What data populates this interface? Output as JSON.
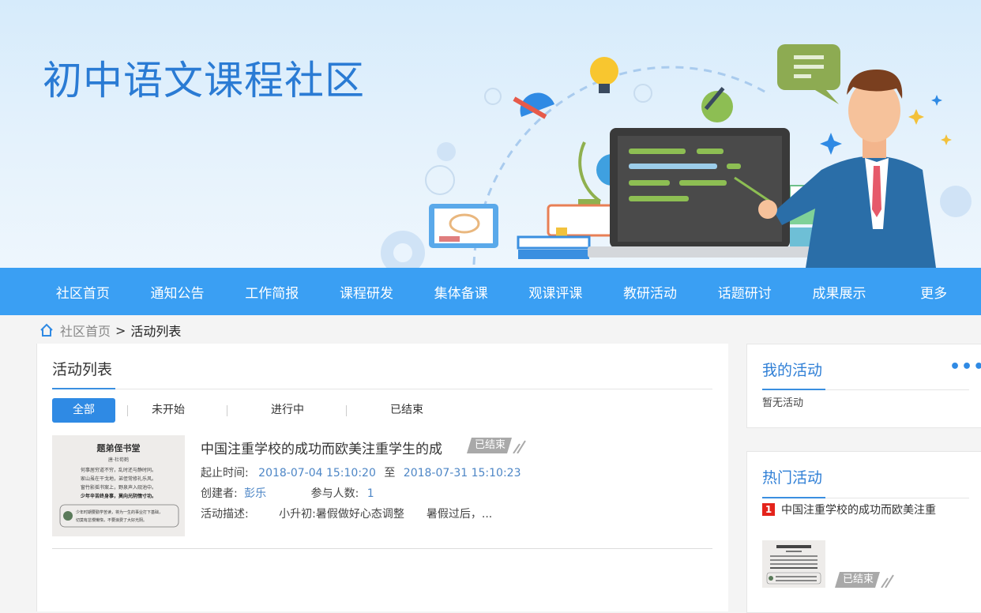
{
  "banner": {
    "title": "初中语文课程社区"
  },
  "nav": {
    "items": [
      "社区首页",
      "通知公告",
      "工作简报",
      "课程研发",
      "集体备课",
      "观课评课",
      "教研活动",
      "话题研讨",
      "成果展示",
      "更多"
    ]
  },
  "breadcrumb": {
    "home": "社区首页",
    "separator": ">",
    "current": "活动列表"
  },
  "main": {
    "title": "活动列表",
    "filters": [
      "全部",
      "未开始",
      "进行中",
      "已结束"
    ],
    "activity": {
      "title": "中国注重学校的成功而欧美注重学生的成",
      "status": "已结束",
      "time_label": "起止时间:",
      "start": "2018-07-04 15:10:20",
      "to": "至",
      "end": "2018-07-31 15:10:23",
      "creator_label": "创建者:",
      "creator": "彭乐",
      "participants_label": "参与人数:",
      "participants": "1",
      "desc_label": "活动描述:",
      "desc": "小升初:暑假做好心态调整　　暑假过后，..."
    },
    "poster": {
      "title": "题弟侄书堂",
      "author": "唐·杜荀鹤",
      "lines": [
        "何事居穷道不穷，乱时还与静时同。",
        "家山虽在干戈地，弟侄常修礼乐风。",
        "窗竹影摇书案上，野泉声入砚池中。",
        "少年辛苦终身事，莫向光阴惰寸功。"
      ],
      "note": [
        "少年时期要勤学苦读，将为一生的事业打下基础，",
        "切莫有怠慢懒惰，不要浪费了大好光阴。"
      ]
    }
  },
  "sidebar": {
    "my_activities": {
      "title": "我的活动",
      "more": "•••",
      "empty": "暂无活动"
    },
    "hot_activities": {
      "title": "热门活动",
      "items": [
        {
          "rank": "1",
          "title": "中国注重学校的成功而欧美注重"
        }
      ],
      "status": "已结束"
    }
  },
  "colors": {
    "nav": "#3a9ff3",
    "accent": "#2f8ae4",
    "title": "#2a7bd4",
    "rank": "#e4231b",
    "badge": "#a9a9a9"
  }
}
